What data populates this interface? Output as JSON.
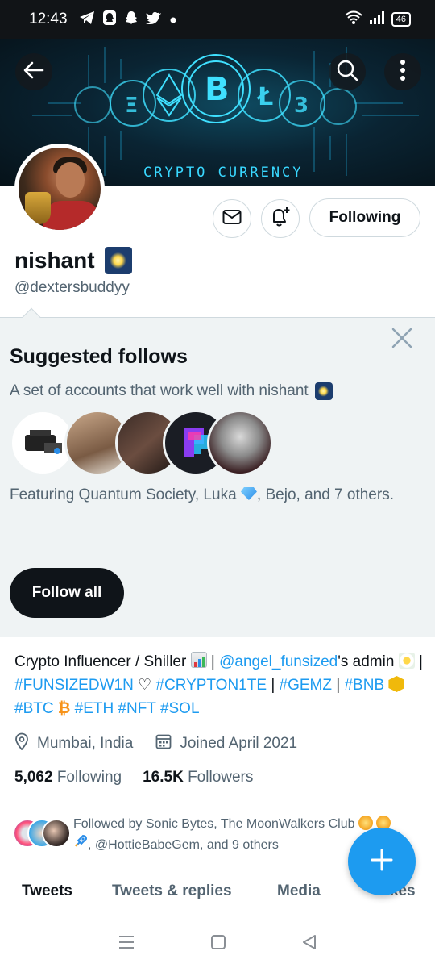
{
  "status_bar": {
    "time": "12:43",
    "battery": "46",
    "notification_icons": [
      "telegram-icon",
      "snapchat-ghost-icon",
      "snapchat-icon",
      "twitter-icon",
      "dot-icon"
    ],
    "system_icons": [
      "wifi-icon",
      "signal-icon",
      "battery-icon"
    ]
  },
  "header": {
    "banner_text": "CRYPTO CURRENCY",
    "back_icon": "back-arrow-icon",
    "search_icon": "search-icon",
    "more_icon": "more-vertical-icon"
  },
  "profile": {
    "name": "nishant",
    "handle": "@dextersbuddyy",
    "message_icon": "mail-icon",
    "notify_icon": "bell-plus-icon",
    "following_label": "Following"
  },
  "suggested": {
    "title": "Suggested follows",
    "subtitle": "A set of accounts that work well with nishant",
    "featuring_prefix": "Featuring Quantum Society, Luka",
    "featuring_suffix": ", Bejo, and 7 others.",
    "follow_all_label": "Follow all",
    "close_icon": "close-icon"
  },
  "bio": {
    "part1": "Crypto Influencer / Shiller",
    "sep1": "|",
    "mention": "@angel_funsized",
    "part2": "'s admin",
    "sep2": "|",
    "tag1": "#FUNSIZEDW1N",
    "heart": "♡",
    "tag2": "#CRYPTON1TE",
    "sep3": "|",
    "tag3": "#GEMZ",
    "sep4": "|",
    "tag4": "#BNB",
    "tag5": "#BTC",
    "tag6": "#ETH",
    "tag7": "#NFT",
    "tag8": "#SOL"
  },
  "meta": {
    "location": "Mumbai, India",
    "joined": "Joined April 2021"
  },
  "stats": {
    "following_count": "5,062",
    "following_label": "Following",
    "followers_count": "16.5K",
    "followers_label": "Followers"
  },
  "followed_by": {
    "line1": "Followed by Sonic Bytes, The MoonWalkers Club",
    "line2": ", @HottieBabeGem, and 9 others"
  },
  "tabs": {
    "items": [
      "Tweets",
      "Tweets & replies",
      "Media",
      "Likes"
    ]
  },
  "fab": {
    "icon": "plus-icon"
  },
  "colors": {
    "accent": "#1d9bf0",
    "text": "#0f1419",
    "muted": "#536471",
    "panel": "#eff3f4"
  }
}
